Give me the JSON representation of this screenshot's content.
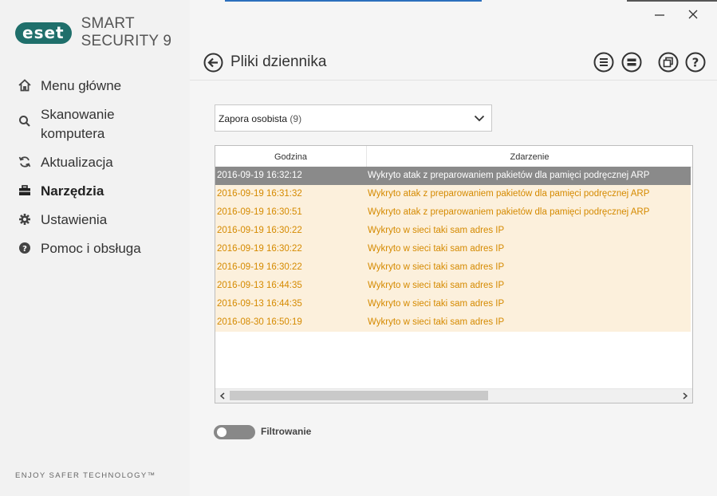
{
  "app": {
    "brand_badge": "eset",
    "product_name": "SMART SECURITY 9",
    "footer_tagline": "ENJOY SAFER TECHNOLOGY™",
    "accent_color": "#1f6f6b"
  },
  "sidebar": {
    "items": [
      {
        "label": "Menu główne",
        "icon": "home-icon"
      },
      {
        "label": "Skanowanie komputera",
        "icon": "search-icon"
      },
      {
        "label": "Aktualizacja",
        "icon": "refresh-icon"
      },
      {
        "label": "Narzędzia",
        "icon": "toolbox-icon",
        "active": true
      },
      {
        "label": "Ustawienia",
        "icon": "gear-icon"
      },
      {
        "label": "Pomoc i obsługa",
        "icon": "help-icon"
      }
    ]
  },
  "header": {
    "title": "Pliki dziennika"
  },
  "filter_select": {
    "value": "Zapora osobista",
    "count": "(9)"
  },
  "table": {
    "columns": [
      "Godzina",
      "Zdarzenie"
    ],
    "rows": [
      {
        "time": "2016-09-19 16:32:12",
        "event": "Wykryto atak z preparowaniem pakietów dla pamięci podręcznej ARP",
        "selected": true
      },
      {
        "time": "2016-09-19 16:31:32",
        "event": "Wykryto atak z preparowaniem pakietów dla pamięci podręcznej ARP"
      },
      {
        "time": "2016-09-19 16:30:51",
        "event": "Wykryto atak z preparowaniem pakietów dla pamięci podręcznej ARP"
      },
      {
        "time": "2016-09-19 16:30:22",
        "event": "Wykryto w sieci taki sam adres IP"
      },
      {
        "time": "2016-09-19 16:30:22",
        "event": "Wykryto w sieci taki sam adres IP"
      },
      {
        "time": "2016-09-19 16:30:22",
        "event": "Wykryto w sieci taki sam adres IP"
      },
      {
        "time": "2016-09-13 16:44:35",
        "event": "Wykryto w sieci taki sam adres IP"
      },
      {
        "time": "2016-09-13 16:44:35",
        "event": "Wykryto w sieci taki sam adres IP"
      },
      {
        "time": "2016-08-30 16:50:19",
        "event": "Wykryto w sieci taki sam adres IP"
      }
    ],
    "row_color": "#fcf0dc",
    "row_text_color": "#d58a00",
    "selected_color": "#8a8a8a"
  },
  "filtering": {
    "label": "Filtrowanie",
    "enabled": false
  }
}
